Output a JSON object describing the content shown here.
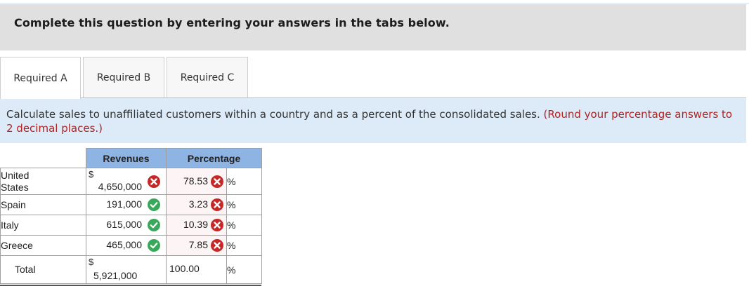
{
  "banner": {
    "text": "Complete this question by entering your answers in the tabs below."
  },
  "tabs": [
    {
      "label": "Required A",
      "active": true
    },
    {
      "label": "Required B",
      "active": false
    },
    {
      "label": "Required C",
      "active": false
    }
  ],
  "instruction": {
    "text": "Calculate sales to unaffiliated customers within a country and as a percent of the consolidated sales.",
    "note": "(Round your percentage answers to 2 decimal places.)"
  },
  "table": {
    "headers": {
      "revenues": "Revenues",
      "percentage": "Percentage"
    },
    "rows": [
      {
        "label": "United States",
        "currency": "$",
        "revenue": "4,650,000",
        "revenue_status": "incorrect",
        "percentage": "78.53",
        "percentage_status": "incorrect",
        "unit": "%"
      },
      {
        "label": "Spain",
        "currency": "",
        "revenue": "191,000",
        "revenue_status": "correct",
        "percentage": "3.23",
        "percentage_status": "incorrect",
        "unit": "%"
      },
      {
        "label": "Italy",
        "currency": "",
        "revenue": "615,000",
        "revenue_status": "correct",
        "percentage": "10.39",
        "percentage_status": "incorrect",
        "unit": "%"
      },
      {
        "label": "Greece",
        "currency": "",
        "revenue": "465,000",
        "revenue_status": "correct",
        "percentage": "7.85",
        "percentage_status": "incorrect",
        "unit": "%"
      }
    ],
    "total": {
      "label": "Total",
      "currency": "$",
      "revenue": "5,921,000",
      "percentage": "100.00",
      "unit": "%"
    }
  },
  "colors": {
    "correct": "#3aa85a",
    "incorrect": "#c62828",
    "header": "#8db4e2",
    "instruction_bg": "#dcebf7",
    "note_red": "#b22222"
  }
}
